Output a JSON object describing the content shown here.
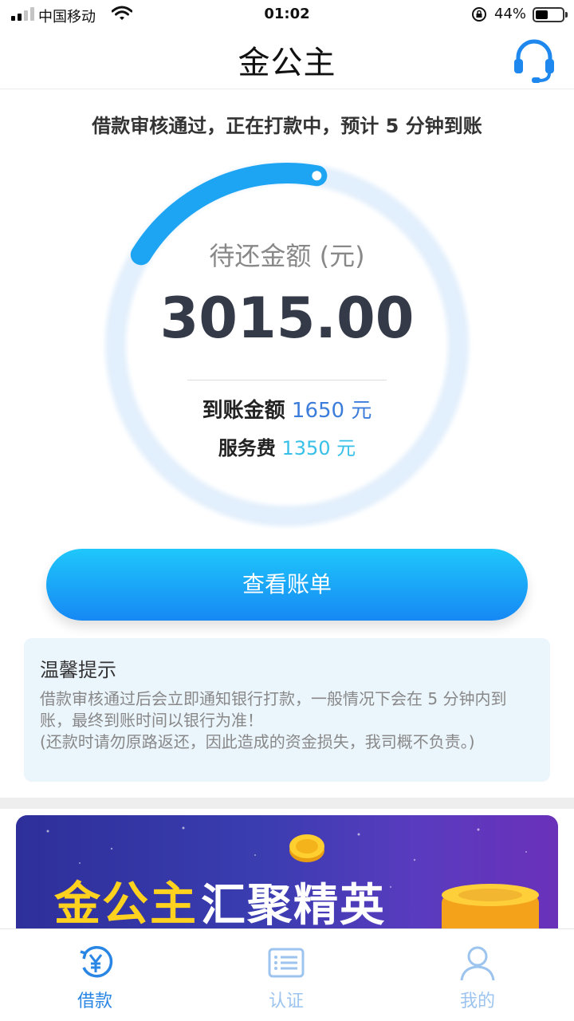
{
  "status_bar": {
    "carrier": "中国移动",
    "time": "01:02",
    "battery": "44%"
  },
  "nav": {
    "title": "金公主",
    "support_icon": "headset-icon"
  },
  "notice": "借款审核通过，正在打款中，预计 5 分钟到账",
  "summary": {
    "label": "待还金额 (元)",
    "amount": "3015.00",
    "progress": 0.19,
    "received_label": "到账金额",
    "received_value": "1650 元",
    "fee_label": "服务费",
    "fee_value": "1350 元"
  },
  "view_bill_button": "查看账单",
  "tip": {
    "title": "温馨提示",
    "line1": "借款审核通过后会立即通知银行打款，一般情况下会在 5 分钟内到账，最终到账时间以银行为准！",
    "line2": "(还款时请勿原路返还，因此造成的资金损失，我司概不负责。)"
  },
  "banner": {
    "title_brand": "金公主",
    "title_slogan": "汇聚精英"
  },
  "tabbar": [
    {
      "label": "借款",
      "icon": "loan-yen-icon",
      "active": true
    },
    {
      "label": "认证",
      "icon": "id-card-icon",
      "active": false
    },
    {
      "label": "我的",
      "icon": "user-icon",
      "active": false
    }
  ],
  "colors": {
    "accent": "#1e9cf3",
    "active_tab": "#2a86e4",
    "inactive_tab": "#9cc4ef",
    "amount": "#343a48"
  }
}
